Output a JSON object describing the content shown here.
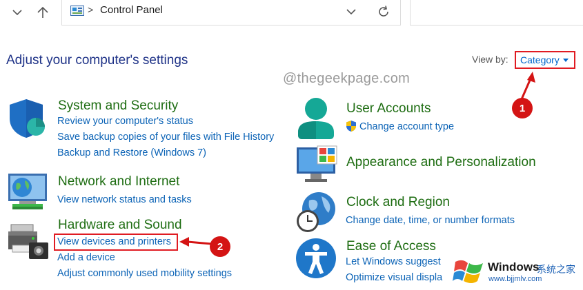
{
  "address_bar": {
    "breadcrumb": "Control Panel",
    "separator": ">"
  },
  "header": {
    "title": "Adjust your computer's settings",
    "view_by_label": "View by:",
    "view_by_value": "Category"
  },
  "watermark": "@thegeekpage.com",
  "categories": [
    {
      "title": "System and Security",
      "icon": "shield-icon",
      "links": [
        "Review your computer's status",
        "Save backup copies of your files with File History",
        "Backup and Restore (Windows 7)"
      ]
    },
    {
      "title": "Network and Internet",
      "icon": "network-globe-icon",
      "links": [
        "View network status and tasks"
      ]
    },
    {
      "title": "Hardware and Sound",
      "icon": "printer-icon",
      "links": [
        "View devices and printers",
        "Add a device",
        "Adjust commonly used mobility settings"
      ]
    },
    {
      "title": "User Accounts",
      "icon": "user-icon",
      "links": [
        "Change account type"
      ]
    },
    {
      "title": "Appearance and Personalization",
      "icon": "monitor-icon",
      "links": []
    },
    {
      "title": "Clock and Region",
      "icon": "clock-globe-icon",
      "links": [
        "Change date, time, or number formats"
      ]
    },
    {
      "title": "Ease of Access",
      "icon": "accessibility-icon",
      "links": [
        "Let Windows suggest",
        "Optimize visual displa"
      ]
    }
  ],
  "annotations": {
    "badge_1": "1",
    "badge_2": "2"
  },
  "win_watermark": {
    "brand": "Windows",
    "cn": "系统之家",
    "url": "www.bjjmlv.com"
  },
  "colors": {
    "title_blue": "#1e3287",
    "category_green": "#1e6d12",
    "link_blue": "#0b63b6",
    "annotation_red": "#e01b22"
  }
}
